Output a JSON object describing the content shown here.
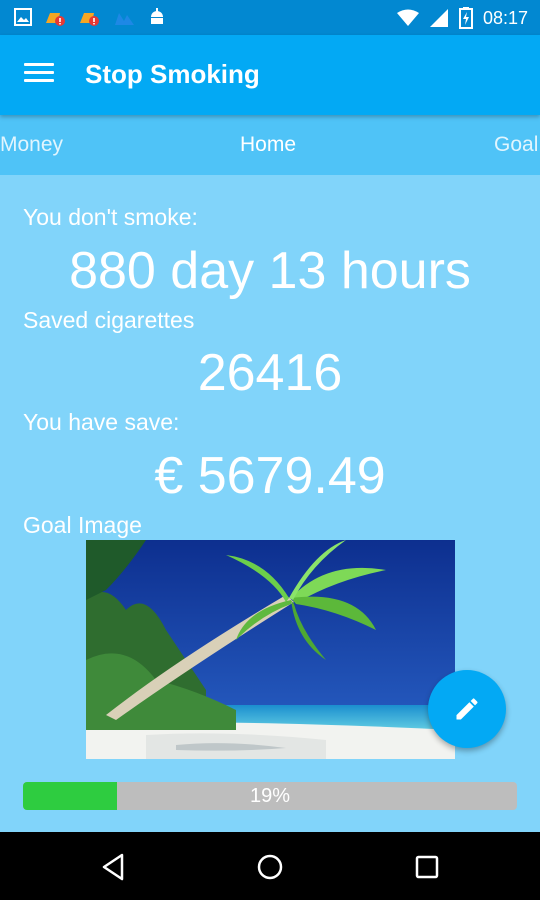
{
  "status_bar": {
    "time": "08:17"
  },
  "app_bar": {
    "title": "Stop Smoking"
  },
  "tabs": [
    {
      "label": "Money"
    },
    {
      "label": "Home"
    },
    {
      "label": "Goal"
    }
  ],
  "active_tab": "Home",
  "stats": {
    "smoke_free_label": "You don't smoke:",
    "smoke_free_value": "880 day 13 hours",
    "saved_cigarettes_label": "Saved cigarettes",
    "saved_cigarettes_value": "26416",
    "money_saved_label": "You have save:",
    "money_saved_value": "€ 5679.49",
    "goal_image_label": "Goal Image"
  },
  "progress": {
    "percent": 19,
    "label": "19%"
  },
  "colors": {
    "status_bar": "#0288d1",
    "app_bar": "#03a9f4",
    "tabs_bg": "#4fc3f7",
    "content_bg": "#81d4fa",
    "progress_fill": "#2ecc40",
    "progress_track": "#bdbdbd"
  },
  "icons": {
    "fab": "pencil-icon",
    "nav": [
      "back-icon",
      "home-icon",
      "recents-icon"
    ]
  }
}
